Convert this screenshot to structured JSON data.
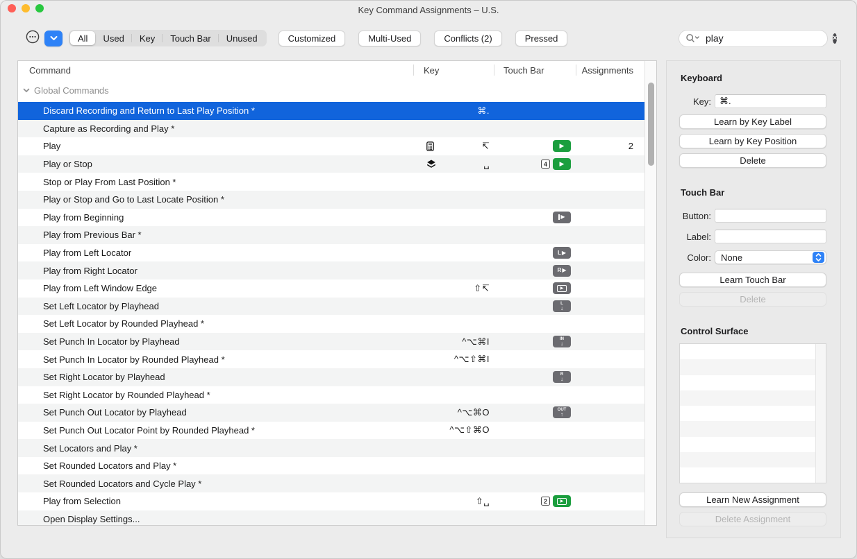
{
  "window": {
    "title": "Key Command Assignments – U.S."
  },
  "toolbar": {
    "action_menu_icon": "ellipsis-circle-icon",
    "dropdown_icon": "chevron-down-icon",
    "segments": [
      "All",
      "Used",
      "Key",
      "Touch Bar",
      "Unused"
    ],
    "selected_segment": "All",
    "filter_buttons": [
      "Customized",
      "Multi-Used",
      "Conflicts (2)",
      "Pressed"
    ],
    "search": {
      "value": "play",
      "icon": "search-icon",
      "clear_icon": "clear-circle-icon"
    }
  },
  "table": {
    "columns": [
      "Command",
      "Key",
      "Touch Bar",
      "Assignments"
    ],
    "group_label": "Global Commands",
    "rows": [
      {
        "name": "Discard Recording and Return to Last Play Position *",
        "key": "⌘.",
        "selected": true
      },
      {
        "name": "Capture as Recording and Play *"
      },
      {
        "name": "Play",
        "key_icon": "keypad-icon",
        "key": "↸",
        "tb": [
          {
            "icon": "play-green"
          }
        ],
        "assignments": "2"
      },
      {
        "name": "Play or Stop",
        "key_icon": "layers-icon",
        "key": "␣",
        "tb": [
          {
            "icon": "badge",
            "value": "4"
          },
          {
            "icon": "play-green"
          }
        ]
      },
      {
        "name": "Stop or Play From Last Position *"
      },
      {
        "name": "Play or Stop and Go to Last Locate Position *"
      },
      {
        "name": "Play from Beginning",
        "tb": [
          {
            "icon": "play-from-beginning"
          }
        ]
      },
      {
        "name": "Play from Previous Bar *"
      },
      {
        "name": "Play from Left Locator",
        "tb": [
          {
            "icon": "play-from-left-locator"
          }
        ]
      },
      {
        "name": "Play from Right Locator",
        "tb": [
          {
            "icon": "play-from-right-locator"
          }
        ]
      },
      {
        "name": "Play from Left Window Edge",
        "key": "⇧↸",
        "tb": [
          {
            "icon": "play-window"
          }
        ]
      },
      {
        "name": "Set Left Locator by Playhead",
        "tb": [
          {
            "icon": "set-left-locator"
          }
        ]
      },
      {
        "name": "Set Left Locator by Rounded Playhead *"
      },
      {
        "name": "Set Punch In Locator by Playhead",
        "key": "^⌥⌘I",
        "tb": [
          {
            "icon": "set-punch-in"
          }
        ]
      },
      {
        "name": "Set Punch In Locator by Rounded Playhead *",
        "key": "^⌥⇧⌘I"
      },
      {
        "name": "Set Right Locator by Playhead",
        "tb": [
          {
            "icon": "set-right-locator"
          }
        ]
      },
      {
        "name": "Set Right Locator by Rounded Playhead *"
      },
      {
        "name": "Set Punch Out Locator by Playhead",
        "key": "^⌥⌘O",
        "tb": [
          {
            "icon": "set-punch-out"
          }
        ]
      },
      {
        "name": "Set Punch Out Locator Point by Rounded Playhead *",
        "key": "^⌥⇧⌘O"
      },
      {
        "name": "Set Locators and Play *"
      },
      {
        "name": "Set Rounded Locators and Play *"
      },
      {
        "name": "Set Rounded Locators and Cycle Play *"
      },
      {
        "name": "Play from Selection",
        "key": "⇧␣",
        "tb": [
          {
            "icon": "badge",
            "value": "2"
          },
          {
            "icon": "play-green-framed"
          }
        ]
      },
      {
        "name": "Open Display Settings..."
      }
    ]
  },
  "panel": {
    "keyboard": {
      "heading": "Keyboard",
      "key_label": "Key:",
      "key_value": "⌘.",
      "learn_by_label": "Learn by Key Label",
      "learn_by_position": "Learn by Key Position",
      "delete": "Delete"
    },
    "touch_bar": {
      "heading": "Touch Bar",
      "button_label": "Button:",
      "button_value": "",
      "label_label": "Label:",
      "label_value": "",
      "color_label": "Color:",
      "color_value": "None",
      "learn": "Learn Touch Bar",
      "delete": "Delete"
    },
    "control_surface": {
      "heading": "Control Surface",
      "learn": "Learn New Assignment",
      "delete": "Delete Assignment"
    }
  },
  "colors": {
    "accent_blue": "#2e82f7",
    "selection_blue": "#1164dc",
    "touchbar_green": "#1b9e3e",
    "touchbar_gray": "#6b6b70",
    "traffic_red": "#ff5f57",
    "traffic_yellow": "#febc2e",
    "traffic_green": "#28c840"
  }
}
